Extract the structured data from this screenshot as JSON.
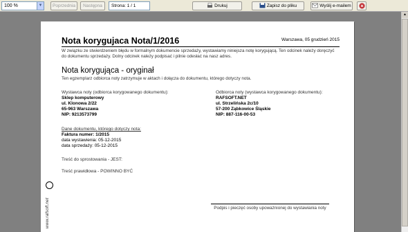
{
  "toolbar": {
    "zoom_value": "100 %",
    "prev_label": "Poprzednia",
    "next_label": "Następna",
    "page_label": "Strona: 1 / 1",
    "print_label": "Drukuj",
    "save_label": "Zapisz do pliku",
    "email_label": "Wyślij e-mailem"
  },
  "document": {
    "title": "Nota korygujaca Nota/1/2016",
    "date": "Warszawa, 05 grudzień 2015",
    "intro": "W związku ze stwierdzeniem błędu w formalnym dokumencie sprzedaży, wystawiamy niniejsza notę korygującą. Ten odcinek należy doręczyć do dokumentu sprzedaży. Dolny odcinek należy podpisać i pilnie odesłać na nasz adres.",
    "subtitle": "Nota korygująca - oryginał",
    "subnote": "Ten egzemplarz odbiorca noty zatrzymuje w aktach i dołącza do dokumentu, którego dotyczy nota.",
    "seller": {
      "heading": "Wystawca noty (odbiorca korygowanego dokumentu):",
      "name": "Sklep komputerowy",
      "street": "ul. Klonowa 2/22",
      "city": "65-963 Warszawa",
      "nip": "NIP: 9213573799"
    },
    "buyer": {
      "heading": "Odbiorca noty (wystawca korygowanego dokumentu):",
      "name": "RAFSOFT.NET",
      "street": "ul. Strzelińska 2c/10",
      "city": "57-200 Ząbkowice Śląskie",
      "nip": "NIP: 887-116-00-53"
    },
    "doc_data": {
      "heading": "Dane dokumentu, którego dotyczy nota:",
      "invoice": "Faktura numer: 1/2015",
      "issue_date": "data wystawienia: 05-12-2015",
      "sale_date": "data sprzedaży: 05-12-2015"
    },
    "correction_line": "Treść do sprostowania - JEST:",
    "correct_line": "Treść prawidłowa - POWINNO BYĆ",
    "signature_label": "Podpis i pieczęć osoby upoważnionej do wystawiania noty",
    "vertical_url": "www.rafsoft.net"
  },
  "colors": {
    "toolbar_bg": "#ece9d8",
    "viewer_bg": "#808080"
  }
}
